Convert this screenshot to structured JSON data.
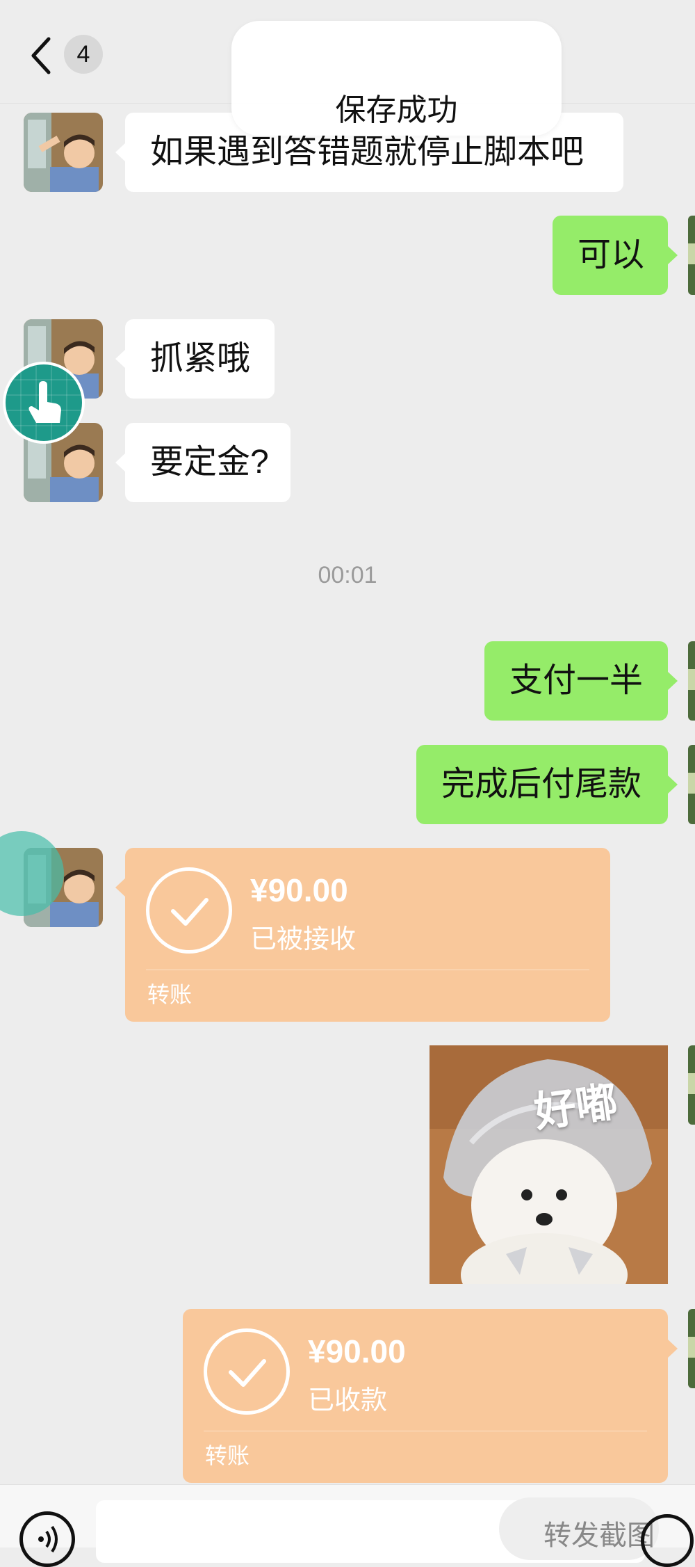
{
  "header": {
    "unread_count": "4"
  },
  "toast": {
    "text": "保存成功"
  },
  "messages": {
    "m1": "如果遇到答错题就停止脚本吧",
    "m2": "可以",
    "m3": "抓紧哦",
    "m4": "要定金?",
    "timestamp": "00:01",
    "m5": "支付一半",
    "m6": "完成后付尾款"
  },
  "transfer_received": {
    "amount": "¥90.00",
    "status": "已被接收",
    "label": "转账"
  },
  "sticker": {
    "text": "好嘟"
  },
  "transfer_sent": {
    "amount": "¥90.00",
    "status": "已收款",
    "label": "转账"
  },
  "bottom_bar": {
    "screenshot_label": "转发截图"
  },
  "colors": {
    "background": "#ededed",
    "incoming_bubble": "#ffffff",
    "outgoing_bubble": "#95ec69",
    "transfer_card": "#f9c89b",
    "floating_button": "#1e9a8a"
  },
  "icons": [
    "back-icon",
    "hand-pointer-icon",
    "check-icon",
    "voice-icon",
    "emoji-icon"
  ]
}
